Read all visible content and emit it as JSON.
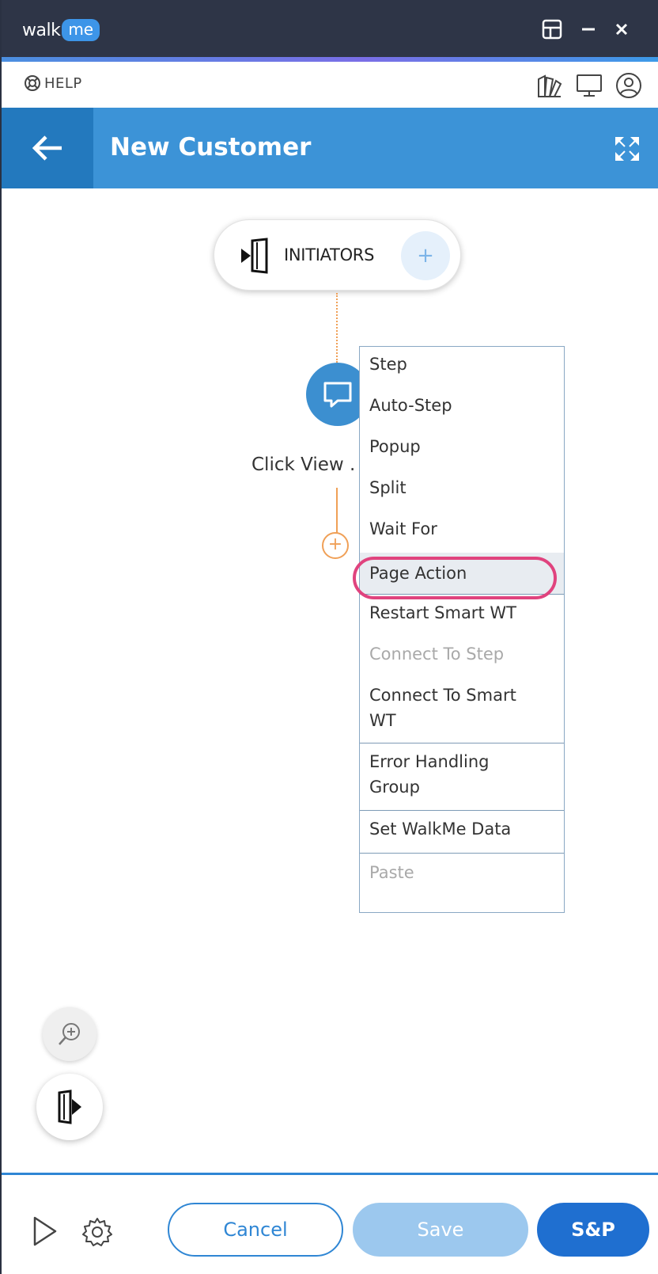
{
  "app": {
    "logo_walk": "walk",
    "logo_me": "me"
  },
  "helpbar": {
    "help_label": "HELP"
  },
  "header": {
    "title": "New Customer"
  },
  "canvas": {
    "initiators_label": "INITIATORS",
    "initiators_add": "+",
    "step_label": "Click View .",
    "add_step": "+"
  },
  "menu": {
    "items": [
      {
        "label": "Step",
        "enabled": true
      },
      {
        "label": "Auto-Step",
        "enabled": true
      },
      {
        "label": "Popup",
        "enabled": true
      },
      {
        "label": "Split",
        "enabled": true
      },
      {
        "label": "Wait For",
        "enabled": true
      },
      {
        "label": "Page Action",
        "enabled": true,
        "highlighted": true
      },
      {
        "label": "Restart Smart WT",
        "enabled": true
      },
      {
        "label": "Connect To Step",
        "enabled": false
      },
      {
        "label": "Connect To Smart WT",
        "enabled": true
      },
      {
        "label": "Error Handling Group",
        "enabled": true
      },
      {
        "label": "Set WalkMe Data",
        "enabled": true
      },
      {
        "label": "Paste",
        "enabled": false
      }
    ]
  },
  "footer": {
    "cancel_label": "Cancel",
    "save_label": "Save",
    "sp_label": "S&P"
  },
  "colors": {
    "titlebar": "#2e3547",
    "header": "#3c93d7",
    "back_button": "#2379be",
    "accent_orange": "#f0a057",
    "highlight_ring": "#e0437e",
    "primary_blue": "#1f6fd0"
  }
}
